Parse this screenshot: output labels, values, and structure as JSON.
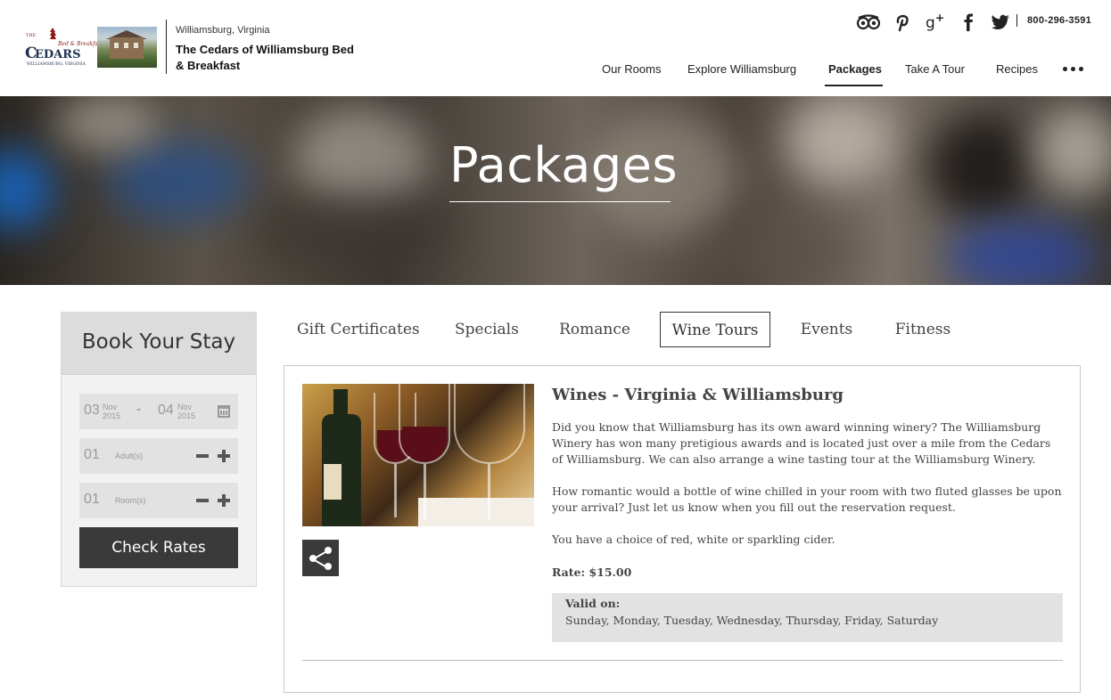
{
  "header": {
    "logo_alt": "The Cedars Bed & Breakfast, Williamsburg, Virginia",
    "location": "Williamsburg, Virginia",
    "site_name": "The Cedars of Williamsburg Bed & Breakfast",
    "social_icons": [
      "tripadvisor-icon",
      "pinterest-icon",
      "google-plus-icon",
      "facebook-icon",
      "twitter-icon"
    ],
    "phone": "800-296-3591",
    "nav": [
      "Our Rooms",
      "Explore Williamsburg",
      "Packages",
      "Take A Tour",
      "Recipes"
    ],
    "nav_active": "Packages",
    "more_icon": "more-dots-icon"
  },
  "hero": {
    "title": "Packages"
  },
  "booking": {
    "title": "Book Your Stay",
    "checkin": {
      "day": "03",
      "month": "Nov",
      "year": "2015"
    },
    "checkout": {
      "day": "04",
      "month": "Nov",
      "year": "2015"
    },
    "adults": {
      "value": "01",
      "label": "Adult(s)"
    },
    "rooms": {
      "value": "01",
      "label": "Room(s)"
    },
    "button": "Check Rates"
  },
  "tabs": [
    "Gift Certificates",
    "Specials",
    "Romance",
    "Wine Tours",
    "Events",
    "Fitness"
  ],
  "active_tab": "Wine Tours",
  "package": {
    "title": "Wines - Virginia & Williamsburg",
    "paragraphs": [
      "Did you know that Williamsburg has its own award winning winery? The Williamsburg Winery has won many pretigious awards and is located just over a mile from the Cedars of Williamsburg.  We can also arrange a wine tasting tour at the Williamsburg Winery.",
      "How romantic would a bottle of wine chilled in your room with two fluted glasses be upon your arrival? Just let us know when you fill out the reservation request.",
      "You have a choice of red, white or sparkling cider."
    ],
    "rate": "Rate: $15.00",
    "valid_label": "Valid on:",
    "valid_days": "Sunday, Monday, Tuesday, Wednesday, Thursday, Friday, Saturday"
  },
  "colors": {
    "dark": "#3a3a3a",
    "panel_bg": "#f2f2f2",
    "field_bg": "#e2e2e2"
  }
}
